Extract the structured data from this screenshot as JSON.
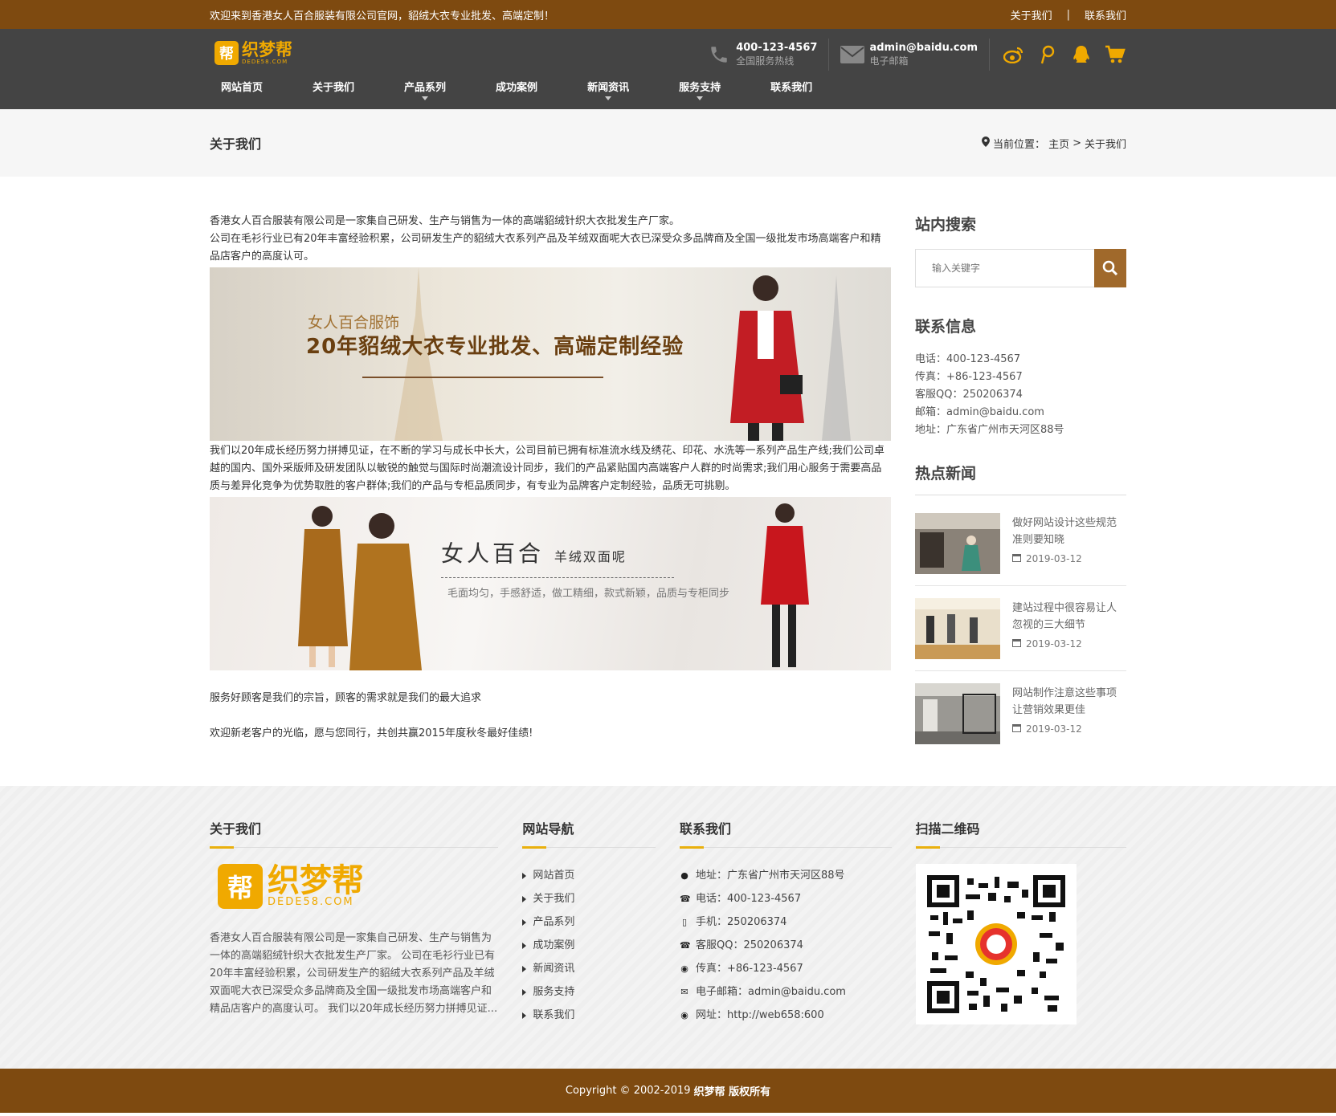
{
  "topbar": {
    "welcome": "欢迎来到香港女人百合服装有限公司官网，貂绒大衣专业批发、高端定制！",
    "about": "关于我们",
    "separator": "|",
    "contact": "联系我们"
  },
  "header": {
    "logo_text": "织梦帮",
    "logo_badge": "帮",
    "logo_sub": "DEDE58.COM",
    "phone": "400-123-4567",
    "phone_label": "全国服务热线",
    "email": "admin@baidu.com",
    "email_label": "电子邮箱",
    "nav": [
      {
        "label": "网站首页"
      },
      {
        "label": "关于我们"
      },
      {
        "label": "产品系列"
      },
      {
        "label": "成功案例"
      },
      {
        "label": "新闻资讯"
      },
      {
        "label": "服务支持"
      },
      {
        "label": "联系我们"
      }
    ]
  },
  "titlebar": {
    "title": "关于我们",
    "crumb_label": "当前位置：",
    "crumb_home": "主页",
    "crumb_sep": ">",
    "crumb_current": "关于我们"
  },
  "content": {
    "p1": "香港女人百合服装有限公司是一家集自己研发、生产与销售为一体的高端貂绒针织大衣批发生产厂家。",
    "p2": "公司在毛衫行业已有20年丰富经验积累，公司研发生产的貂绒大衣系列产品及羊绒双面呢大衣已深受众多品牌商及全国一级批发市场高端客户和精品店客户的高度认可。",
    "banner1_sub": "女人百合服饰",
    "banner1_main": "20年貂绒大衣专业批发、高端定制经验",
    "p3": "我们以20年成长经历努力拼搏见证，在不断的学习与成长中长大，公司目前已拥有标准流水线及绣花、印花、水洗等一系列产品生产线;我们公司卓越的国内、国外采版师及研发团队以敏锐的触觉与国际时尚潮流设计同步，我们的产品紧贴国内高端客户人群的时尚需求;我们用心服务于需要高品质与差异化竞争为优势取胜的客户群体;我们的产品与专柜品质同步，有专业为品牌客户定制经验，品质无可挑剔。",
    "banner2_main": "女人百合",
    "banner2_small": "羊绒双面呢",
    "banner2_sub": "毛面均匀，手感舒适，做工精细，款式新颖，品质与专柜同步",
    "p4": "服务好顾客是我们的宗旨，顾客的需求就是我们的最大追求",
    "p5": "欢迎新老客户的光临，愿与您同行，共创共赢2015年度秋冬最好佳绩!"
  },
  "sidebar": {
    "search_title": "站内搜索",
    "search_placeholder": "输入关键字",
    "contact_title": "联系信息",
    "contact_lines": [
      "电话：400-123-4567",
      "传真：+86-123-4567",
      "客服QQ：250206374",
      "邮箱：admin@baidu.com",
      "地址：广东省广州市天河区88号"
    ],
    "news_title": "热点新闻",
    "news": [
      {
        "title": "做好网站设计这些规范准则要知晓",
        "date": "2019-03-12"
      },
      {
        "title": "建站过程中很容易让人忽视的三大细节",
        "date": "2019-03-12"
      },
      {
        "title": "网站制作注意这些事项让营销效果更佳",
        "date": "2019-03-12"
      }
    ]
  },
  "footer": {
    "about_title": "关于我们",
    "about_text": "香港女人百合服装有限公司是一家集自己研发、生产与销售为一体的高端貂绒针织大衣批发生产厂家。 公司在毛衫行业已有20年丰富经验积累，公司研发生产的貂绒大衣系列产品及羊绒双面呢大衣已深受众多品牌商及全国一级批发市场高端客户和精品店客户的高度认可。 我们以20年成长经历努力拼搏见证...",
    "nav_title": "网站导航",
    "nav": [
      "网站首页",
      "关于我们",
      "产品系列",
      "成功案例",
      "新闻资讯",
      "服务支持",
      "联系我们"
    ],
    "contact_title": "联系我们",
    "contact": [
      {
        "icon": "map-pin-icon",
        "text": "地址：广东省广州市天河区88号"
      },
      {
        "icon": "phone-icon",
        "text": "电话：400-123-4567"
      },
      {
        "icon": "mobile-icon",
        "text": "手机：250206374"
      },
      {
        "icon": "phone-icon",
        "text": "客服QQ：250206374"
      },
      {
        "icon": "globe-icon",
        "text": "传真：+86-123-4567"
      },
      {
        "icon": "envelope-icon",
        "text": "电子邮箱：admin@baidu.com"
      },
      {
        "icon": "globe-icon",
        "text": "网址：http://web658:600"
      }
    ],
    "qr_title": "扫描二维码",
    "copyright": "Copyright © 2002-2019",
    "copyright_brand": "织梦帮 版权所有"
  },
  "colors": {
    "brand_brown": "#7e4a10",
    "header_gray": "#444444",
    "accent_gold": "#f0a900",
    "search_button": "#a0692b"
  }
}
